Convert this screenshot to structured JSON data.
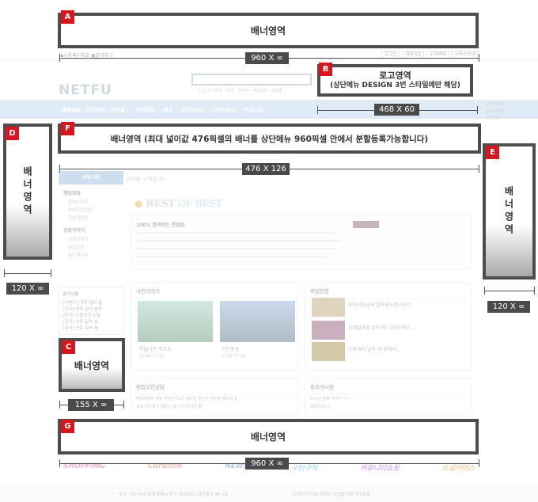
{
  "site": {
    "top_left": "▪시작페이지로  ▣즐겨찾기",
    "top_links": [
      "로그인",
      "회원가입",
      "고객센터",
      "서비스안내"
    ],
    "logo": "NETFU",
    "search_sub": "[인] 인기검색 · PC방 · 일본어 · 주말알바 · 생활물",
    "nav_items": [
      "채용정보 · 업직종별 · 지역별 ·",
      "인재정보",
      "채용",
      "개인서비스",
      "기업서비스",
      "커뮤니티"
    ],
    "nav_right": "금주의채용\n유료서비스\n고객센터",
    "breadcrumb": "HOME > 커뮤니티",
    "side_head": "커뮤니티",
    "side_sections": [
      {
        "title": "취업자료",
        "items": [
          "합격노하우",
          "취업고민상담",
          "취업경험담"
        ]
      },
      {
        "title": "공감이야기",
        "items": [
          "사진이야기",
          "취업현장",
          "유모게시판"
        ]
      }
    ],
    "notice_title": "공지사항",
    "notice_items": [
      "[이벤트] 넷츄 일바 솔",
      "[공지] 넷츄 일바 솔루",
      "[공지] 이용약관 잊을",
      "[공지] 넷츄 일바 솔",
      "[공지] 넷츄 일바 솔"
    ],
    "best_title_a": "BEST",
    "best_title_b": "OF BEST",
    "best_headline": "100% 합격하는 면접법",
    "best_right": "금주에베스트",
    "panel_photo": "사진이야기",
    "panel_field": "취업현장",
    "photo_captions": [
      "하늘다운 폭포수",
      "자연풍경"
    ],
    "photo_dates": [
      "11.06.17.21",
      "11.06.17.19"
    ],
    "field_items": [
      "초보사장님께 알바에보겠나요??",
      "카페알바할 알바 해 그래보세요...",
      "스와케터 알바 해 대해서..."
    ],
    "panel_consult": "취업고민상담",
    "panel_humor": "유모게시판",
    "consult_items": [
      "해외마케팅 알바 무엇인가요? 바다한 곳인가 작성을 해드리 합",
      "접보 이상해서 알바는 임 인가 되어있 물"
    ],
    "humor_items": [
      "유시산 쓸때 치치ㅋㅋㅋ",
      "3D하이브 v"
    ],
    "more_label": "more +",
    "foot_logos": [
      "SHOPPING",
      "Curation",
      "NEWS",
      "구인구직",
      "커뮤니티쇼핑",
      "소셜커머스"
    ],
    "footer_left": "주소 : 50-040 합주광역시 동구 금남로61 남산빌딩 40 1호",
    "footer_right": "온라인 디지털 콘텐츠 산업발전에 의한보호"
  },
  "annotations": {
    "A": {
      "tag": "A",
      "label": "배너영역"
    },
    "B": {
      "tag": "B",
      "label_line1": "로고영역",
      "label_line2": "(상단메뉴 DESIGN 3번 스타일에만 해당)"
    },
    "C": {
      "tag": "C",
      "label": "배너영역"
    },
    "D": {
      "tag": "D",
      "label": "배너영역"
    },
    "E": {
      "tag": "E",
      "label": "배너영역"
    },
    "F": {
      "tag": "F",
      "label": "배너영역 (최대 넓이값 476픽셀의 배너를 상단메뉴 960픽셀 안에서 분할등록가능합니다)"
    },
    "G": {
      "tag": "G",
      "label": "배너영역"
    }
  },
  "dimensions": {
    "top": "960 X ∞",
    "logo": "468 X 60",
    "f_banner": "476 X 126",
    "left": "120 X ∞",
    "right": "120 X ∞",
    "c_banner": "155 X ∞",
    "bottom": "960 X ∞"
  },
  "colors": {
    "tag_red": "#d7161d",
    "frame_gray": "#4d4d4d",
    "nav_blue": "#b7d3ea"
  }
}
